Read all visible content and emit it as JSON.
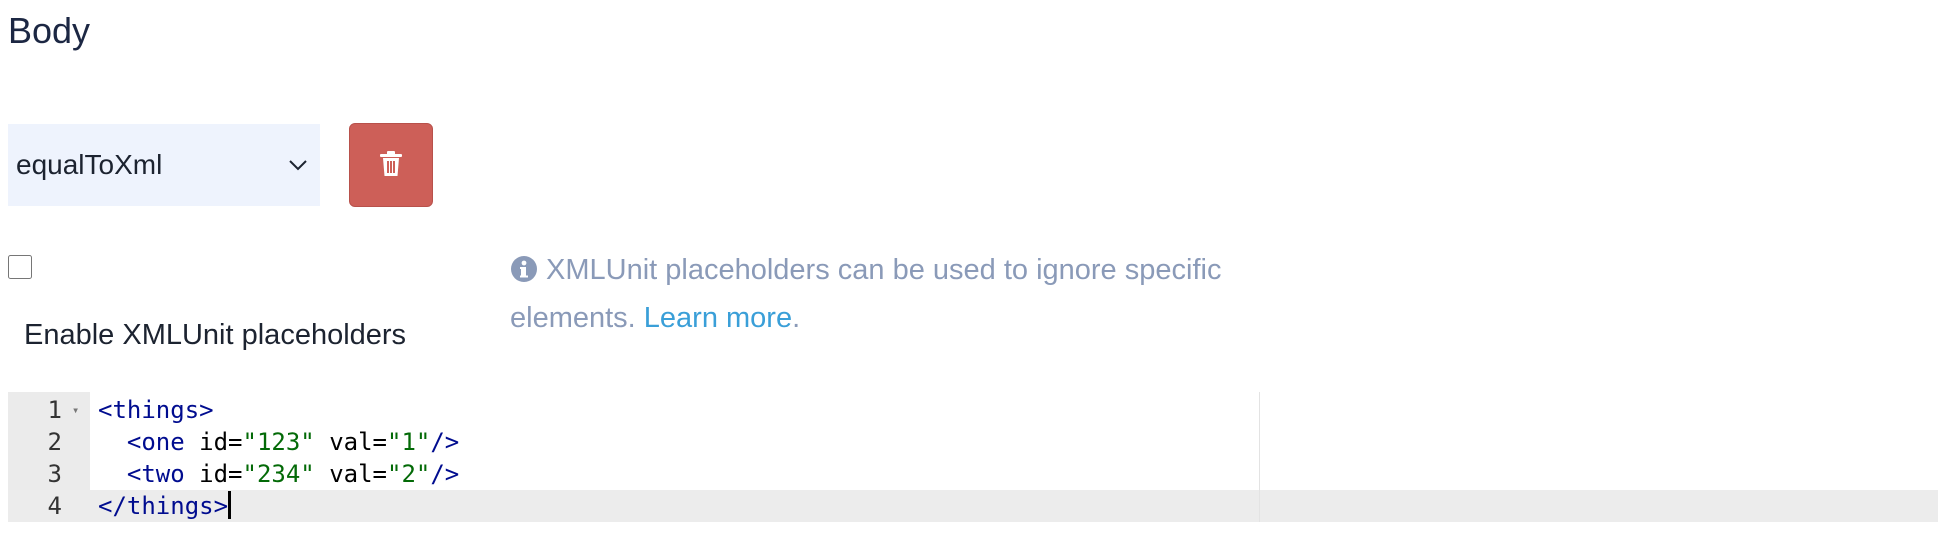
{
  "section": {
    "title": "Body"
  },
  "matcher": {
    "selected": "equalToXml"
  },
  "delete_button": {
    "icon": "trash-icon",
    "color": "#cd5f58"
  },
  "placeholders": {
    "checked": false,
    "label": "Enable XMLUnit placeholders",
    "info_text": "XMLUnit placeholders can be used to ignore specific elements.",
    "link_text": "Learn more",
    "trailing": "."
  },
  "editor": {
    "active_line": 4,
    "lines": [
      {
        "number": "1",
        "foldable": true,
        "tokens": [
          {
            "t": "tag",
            "v": "<things>"
          }
        ]
      },
      {
        "number": "2",
        "foldable": false,
        "tokens": [
          {
            "t": "text",
            "v": "  "
          },
          {
            "t": "tag",
            "v": "<one"
          },
          {
            "t": "attr",
            "v": " id="
          },
          {
            "t": "str",
            "v": "\"123\""
          },
          {
            "t": "attr",
            "v": " val="
          },
          {
            "t": "str",
            "v": "\"1\""
          },
          {
            "t": "tag",
            "v": "/>"
          }
        ]
      },
      {
        "number": "3",
        "foldable": false,
        "tokens": [
          {
            "t": "text",
            "v": "  "
          },
          {
            "t": "tag",
            "v": "<two"
          },
          {
            "t": "attr",
            "v": " id="
          },
          {
            "t": "str",
            "v": "\"234\""
          },
          {
            "t": "attr",
            "v": " val="
          },
          {
            "t": "str",
            "v": "\"2\""
          },
          {
            "t": "tag",
            "v": "/>"
          }
        ]
      },
      {
        "number": "4",
        "foldable": false,
        "tokens": [
          {
            "t": "tag",
            "v": "</things>"
          }
        ]
      }
    ]
  }
}
